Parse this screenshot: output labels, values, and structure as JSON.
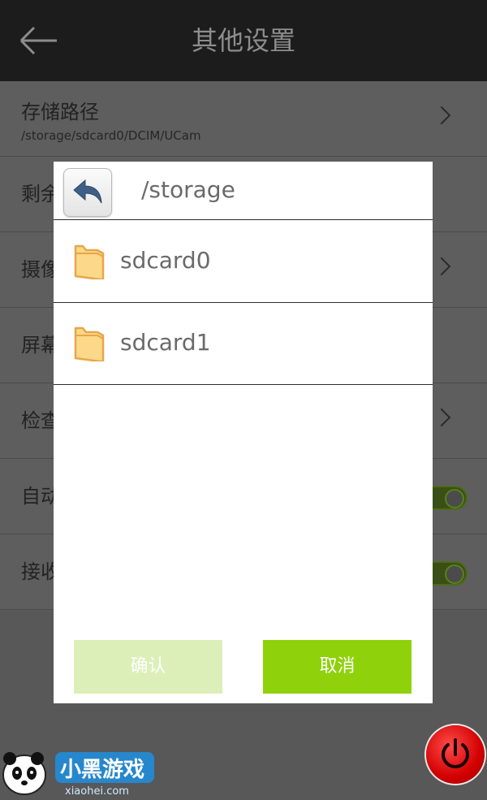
{
  "header": {
    "title": "其他设置",
    "back_icon": "arrow-left-icon"
  },
  "settings": {
    "rows": [
      {
        "label": "存储路径",
        "sub": "/storage/sdcard0/DCIM/UCam",
        "control": "chevron"
      },
      {
        "label": "剩余",
        "control": "none"
      },
      {
        "label": "摄像",
        "control": "chevron"
      },
      {
        "label": "屏幕",
        "control": "none"
      },
      {
        "label": "检查",
        "control": "chevron"
      },
      {
        "label": "自动",
        "control": "toggle"
      },
      {
        "label": "接收",
        "control": "toggle"
      }
    ]
  },
  "dialog": {
    "path": "/storage",
    "up_icon": "undo-arrow-icon",
    "folders": [
      {
        "name": "sdcard0",
        "icon": "folder-icon"
      },
      {
        "name": "sdcard1",
        "icon": "folder-icon"
      }
    ],
    "confirm_label": "确认",
    "cancel_label": "取消"
  },
  "power_icon": "power-icon",
  "watermark": {
    "logo_text": "小黑游戏",
    "url": "xiaohei.com"
  },
  "colors": {
    "header_bg": "#1c1c1c",
    "confirm_disabled": "#dcefb8",
    "cancel_green": "#8fd10a",
    "power_red": "#e00000"
  }
}
